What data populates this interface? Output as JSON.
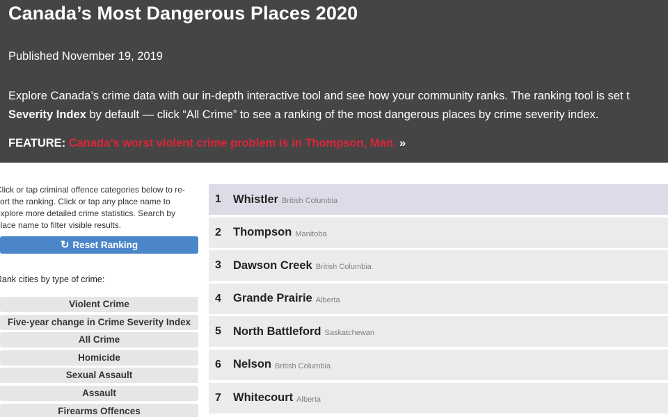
{
  "header": {
    "title": "Canada’s Most Dangerous Places 2020",
    "published": "Published November 19, 2019",
    "intro_line1": "Explore Canada’s crime data with our in-depth interactive tool and see how your community ranks. The ranking tool is set t",
    "intro_line2_bold": "Severity Index",
    "intro_line2_rest": " by default — click “All Crime” to see a ranking of the most dangerous places by crime severity index.",
    "feature_label": "FEATURE:",
    "feature_link": "Canada’s worst violent crime problem is in Thompson, Man.",
    "feature_arrow": "»"
  },
  "sidebar": {
    "help_lines": [
      "Click or tap criminal offence categories below to re-",
      "sort the ranking. Click or tap any place name to",
      "explore more detailed crime statistics. Search by",
      "place name to filter visible results."
    ],
    "reset_label": "Reset Ranking",
    "reset_icon": "refresh-icon",
    "rank_by_label": "Rank cities by type of crime:",
    "crime_types": [
      "Violent Crime",
      "Five-year change in Crime Severity Index",
      "All Crime",
      "Homicide",
      "Sexual Assault",
      "Assault",
      "Firearms Offences"
    ]
  },
  "ranking": [
    {
      "rank": "1",
      "city": "Whistler",
      "province": "British Columbia"
    },
    {
      "rank": "2",
      "city": "Thompson",
      "province": "Manitoba"
    },
    {
      "rank": "3",
      "city": "Dawson Creek",
      "province": "British Columbia"
    },
    {
      "rank": "4",
      "city": "Grande Prairie",
      "province": "Alberta"
    },
    {
      "rank": "5",
      "city": "North Battleford",
      "province": "Saskatchewan"
    },
    {
      "rank": "6",
      "city": "Nelson",
      "province": "British Columbia"
    },
    {
      "rank": "7",
      "city": "Whitecourt",
      "province": "Alberta"
    }
  ],
  "colors": {
    "header_bg": "#454545",
    "feature_link": "#d9263a",
    "reset_button": "#4a86c8",
    "row_bg": "#ebebeb",
    "row_highlight": "#dcdce8"
  }
}
